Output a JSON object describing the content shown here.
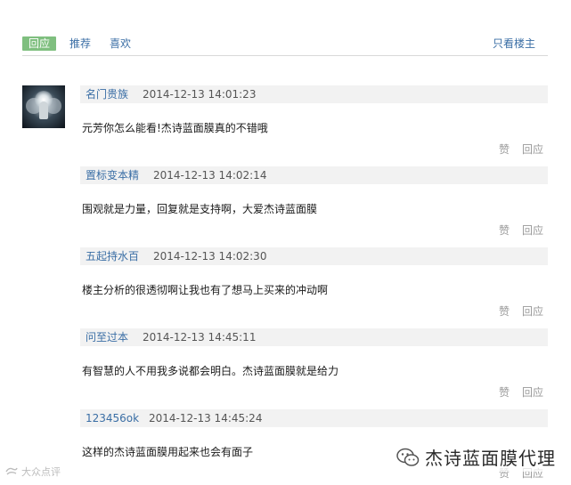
{
  "tabs": [
    {
      "label": "回应"
    },
    {
      "label": "推荐"
    },
    {
      "label": "喜欢"
    }
  ],
  "owner_only_label": "只看楼主",
  "comments": [
    {
      "author": "名门贵族",
      "time": "2014-12-13 14:01:23",
      "text": "元芳你怎么能看!杰诗蓝面膜真的不错哦",
      "like": "赞",
      "reply": "回应"
    },
    {
      "author": "置标变本精",
      "time": "2014-12-13 14:02:14",
      "text": "围观就是力量，回复就是支持啊，大爱杰诗蓝面膜",
      "like": "赞",
      "reply": "回应"
    },
    {
      "author": "五起持水百",
      "time": "2014-12-13 14:02:30",
      "text": "楼主分析的很透彻啊让我也有了想马上买来的冲动啊",
      "like": "赞",
      "reply": "回应"
    },
    {
      "author": "问至过本",
      "time": "2014-12-13 14:45:11",
      "text": "有智慧的人不用我多说都会明白。杰诗蓝面膜就是给力",
      "like": "赞",
      "reply": "回应"
    },
    {
      "author": "123456ok",
      "time": "2014-12-13 14:45:24",
      "text": "这样的杰诗蓝面膜用起来也会有面子",
      "like": "赞",
      "reply": "回应"
    }
  ],
  "watermark_left": "大众点评",
  "watermark_right": "杰诗蓝面膜代理",
  "colors": {
    "accent_tab": "#7fbf7f",
    "link": "#3a6ea5",
    "header_bg": "#f2f2f2"
  }
}
